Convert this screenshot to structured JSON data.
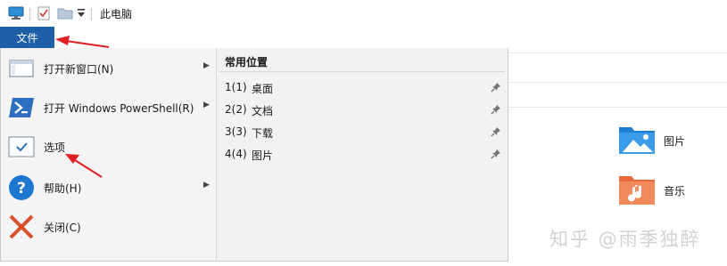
{
  "titlebar": {
    "title": "此电脑",
    "icons": [
      "computer-icon",
      "properties-icon",
      "folder-icon",
      "quick-access-dropdown-icon"
    ]
  },
  "file_tab": {
    "label": "文件"
  },
  "menu": {
    "items": [
      {
        "label": "打开新窗口(N)",
        "icon": "new-window-icon",
        "has_submenu": true
      },
      {
        "label": "打开 Windows PowerShell(R)",
        "icon": "powershell-icon",
        "has_submenu": true
      },
      {
        "label": "选项",
        "icon": "options-checkmark-icon",
        "has_submenu": false
      },
      {
        "label": "帮助(H)",
        "icon": "help-icon",
        "has_submenu": true
      },
      {
        "label": "关闭(C)",
        "icon": "close-icon",
        "has_submenu": false
      }
    ],
    "arrow_glyph": "▶",
    "recent": {
      "heading": "常用位置",
      "items": [
        {
          "num": "1(1)",
          "name": "桌面"
        },
        {
          "num": "2(2)",
          "name": "文档"
        },
        {
          "num": "3(3)",
          "name": "下载"
        },
        {
          "num": "4(4)",
          "name": "图片"
        }
      ]
    }
  },
  "background": {
    "items": [
      {
        "label": "图片",
        "icon": "pictures-folder-icon"
      },
      {
        "label": "音乐",
        "icon": "music-folder-icon"
      }
    ]
  },
  "watermark": {
    "text": "知乎 @雨季独醉"
  },
  "colors": {
    "accent": "#1f5fa8",
    "annotation_arrow": "#e02020"
  }
}
